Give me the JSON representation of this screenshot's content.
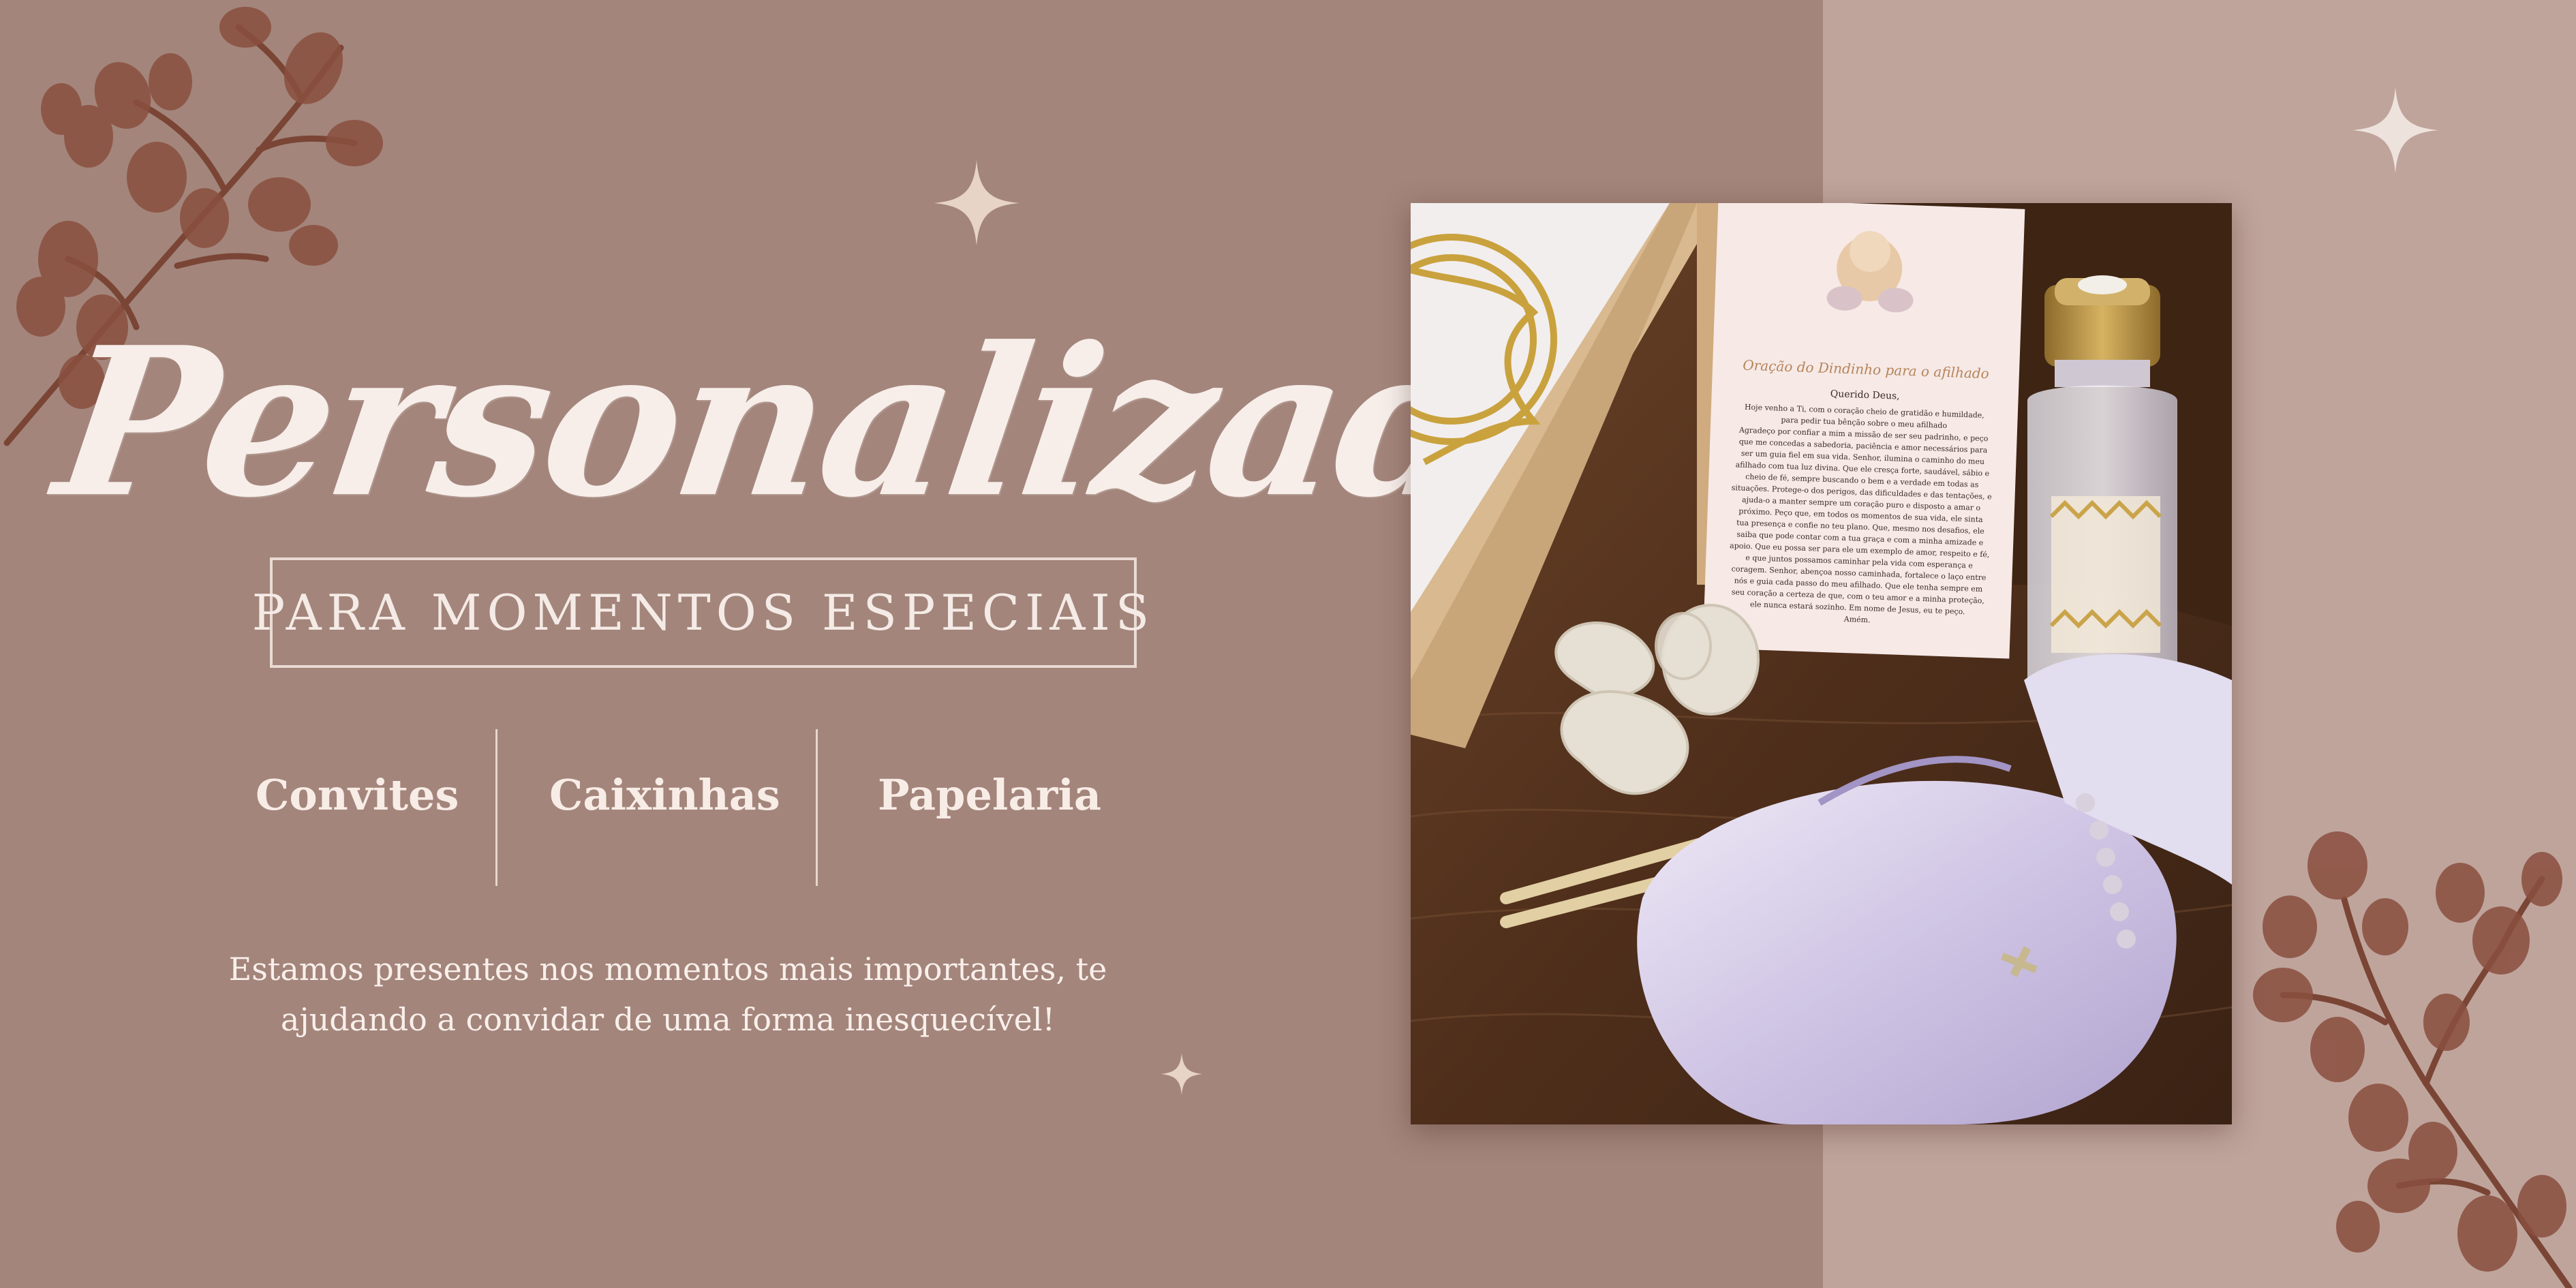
{
  "hero": {
    "title": "Personalizados",
    "subtitle": "PARA MOMENTOS ESPECIAIS"
  },
  "categories": [
    {
      "label": "Convites"
    },
    {
      "label": "Caixinhas"
    },
    {
      "label": "Papelaria"
    }
  ],
  "description": {
    "line1": "Estamos presentes nos momentos mais importantes, te",
    "line2": "ajudando a convidar de uma forma inesquecível!"
  },
  "photo": {
    "card_title": "Oração do Dindinho para o afilhado",
    "card_greeting": "Querido Deus,",
    "card_lines": [
      "Hoje venho a Ti, com o coração cheio de gratidão e humildade,",
      "para pedir tua bênção sobre o meu afilhado",
      "Agradeço por confiar a mim a missão de ser seu padrinho, e peço",
      "que me concedas a sabedoria, paciência e amor necessários para",
      "ser um guia fiel em sua vida. Senhor, ilumina o caminho do meu",
      "afilhado com tua luz divina. Que ele cresça forte, saudável, sábio e",
      "cheio de fé, sempre buscando o bem e a verdade em todas as",
      "situações. Protege-o dos perigos, das dificuldades e das tentações, e",
      "ajuda-o a manter sempre um coração puro e disposto a amar o",
      "próximo. Peço que, em todos os momentos de sua vida, ele sinta",
      "tua presença e confie no teu plano. Que, mesmo nos desafios, ele",
      "saiba que pode contar com a tua graça e com a minha amizade e",
      "apoio. Que eu possa ser para ele um exemplo de amor, respeito e fé,",
      "e que juntos possamos caminhar pela vida com esperança e",
      "coragem. Senhor, abençoa nosso caminhada, fortalece o laço entre",
      "nós e guia cada passo do meu afilhado. Que ele tenha sempre em",
      "seu coração a certeza de que, com o teu amor e a minha proteção,",
      "ele nunca estará sozinho. Em nome de Jesus, eu te peço.",
      "Amém."
    ]
  },
  "colors": {
    "background": "#a3857b",
    "panel": "#bfa49c",
    "text": "#f7eeea",
    "accent_leaf": "#7a4535"
  }
}
